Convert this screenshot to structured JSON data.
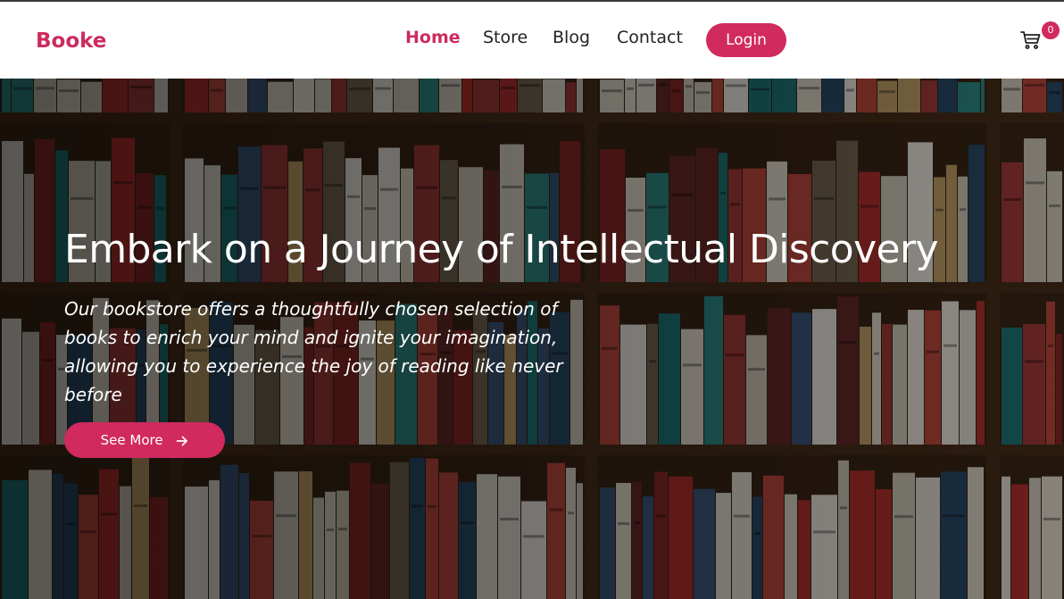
{
  "header": {
    "brand": "Booke",
    "nav": [
      {
        "label": "Home",
        "active": true
      },
      {
        "label": "Store",
        "active": false
      },
      {
        "label": "Blog",
        "active": false
      },
      {
        "label": "Contact",
        "active": false
      }
    ],
    "login_label": "Login",
    "cart_icon": "cart-icon",
    "cart_count": "0"
  },
  "hero": {
    "title": "Embark on a Journey of Intellectual Discovery",
    "description": "Our bookstore offers a thoughtfully chosen selection of books to enrich your mind and ignite your imagination, allowing you to experience the joy of reading like never before",
    "button_label": "See More",
    "button_icon": "arrow-right-icon",
    "background": "bookshelf-image"
  },
  "colors": {
    "accent": "#d12a5f",
    "brand": "#cc2b5e",
    "nav_text": "#222222",
    "header_bg": "#ffffff",
    "hero_text": "#ffffff"
  }
}
